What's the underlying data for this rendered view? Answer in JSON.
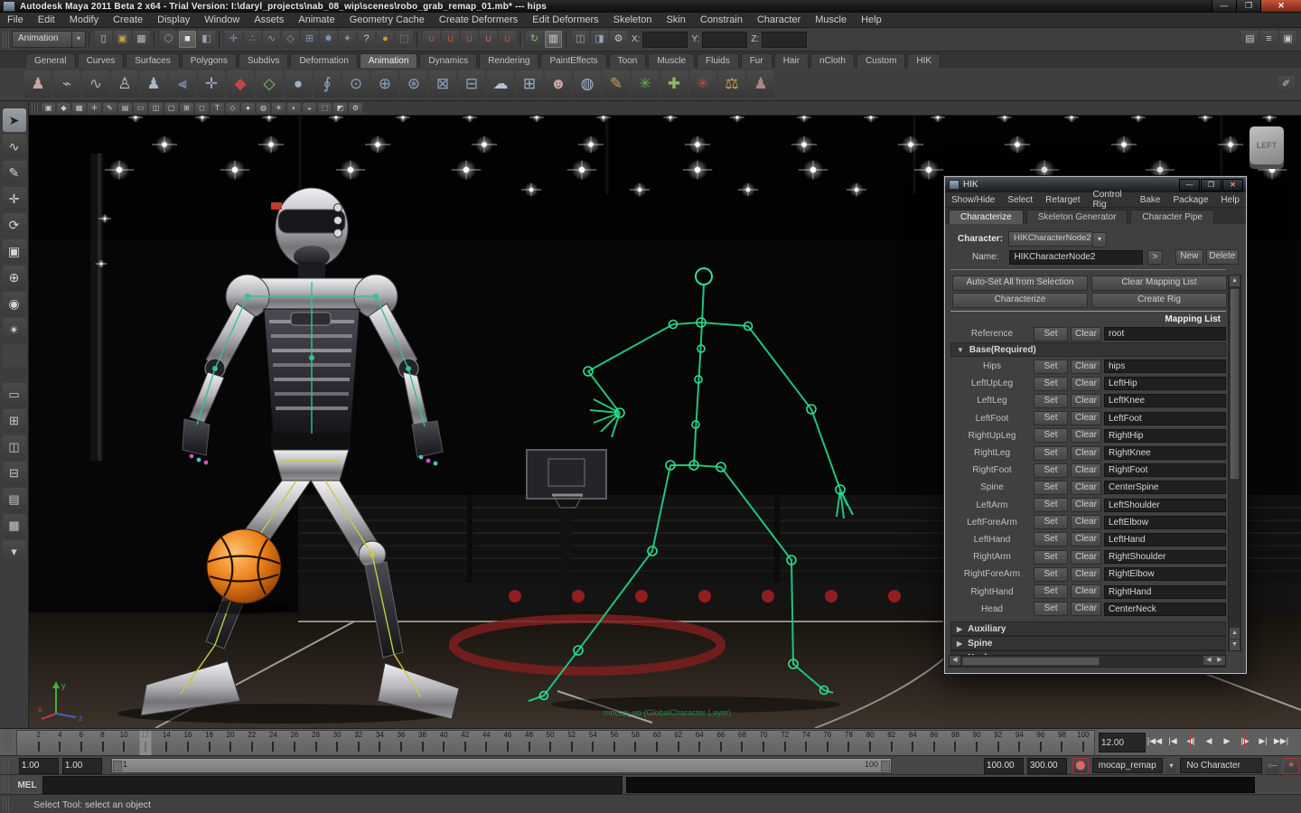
{
  "window": {
    "title": "Autodesk Maya 2011 Beta 2 x64 - Trial Version: I:\\daryl_projects\\nab_08_wip\\scenes\\robo_grab_remap_01.mb*   ---   hips",
    "minimize": "—",
    "maximize": "❐",
    "close": "✕"
  },
  "menu_bar": [
    "File",
    "Edit",
    "Modify",
    "Create",
    "Display",
    "Window",
    "Assets",
    "Animate",
    "Geometry Cache",
    "Create Deformers",
    "Edit Deformers",
    "Skeleton",
    "Skin",
    "Constrain",
    "Character",
    "Muscle",
    "Help"
  ],
  "status_line": {
    "menuset": "Animation",
    "coord_labels": [
      "X:",
      "Y:",
      "Z:"
    ],
    "icons": [
      {
        "n": "new-scene-icon",
        "g": "▯",
        "c": "#c8ced6"
      },
      {
        "n": "open-scene-icon",
        "g": "▣",
        "c": "#c9a24a"
      },
      {
        "n": "save-scene-icon",
        "g": "▦",
        "c": "#b8bec6"
      },
      "|",
      {
        "n": "select-hierarchy-mode-icon",
        "g": "⬡",
        "c": "#9aa4b2"
      },
      {
        "n": "select-object-mode-icon",
        "g": "■",
        "c": "#e0e5ea",
        "active": true
      },
      {
        "n": "select-component-mode-icon",
        "g": "◧",
        "c": "#9aa4b2"
      },
      "|",
      {
        "n": "mask-handles-icon",
        "g": "✛",
        "c": "#7f94b5"
      },
      {
        "n": "mask-joints-icon",
        "g": "∴",
        "c": "#7f94b5"
      },
      {
        "n": "mask-curves-icon",
        "g": "∿",
        "c": "#7f94b5"
      },
      {
        "n": "mask-surfaces-icon",
        "g": "◇",
        "c": "#7f94b5"
      },
      {
        "n": "mask-deformations-icon",
        "g": "⊞",
        "c": "#7f94b5"
      },
      {
        "n": "mask-dynamics-icon",
        "g": "✸",
        "c": "#7f94b5"
      },
      {
        "n": "mask-rendering-icon",
        "g": "✦",
        "c": "#7f94b5"
      },
      {
        "n": "mask-misc-icon",
        "g": "?",
        "c": "#c2c8d0"
      },
      {
        "n": "lock-selection-icon",
        "g": "●",
        "c": "#c9a227"
      },
      {
        "n": "highlight-selection-icon",
        "g": "⬚",
        "c": "#9aa4b2"
      },
      "|",
      {
        "n": "snap-to-grid-icon",
        "g": "∪",
        "c": "#c05040"
      },
      {
        "n": "snap-to-curve-icon",
        "g": "∪",
        "c": "#c05040"
      },
      {
        "n": "snap-to-point-icon",
        "g": "∪",
        "c": "#c05040"
      },
      {
        "n": "snap-to-projected-center-icon",
        "g": "∪",
        "c": "#b07070"
      },
      {
        "n": "snap-to-view-plane-icon",
        "g": "∪",
        "c": "#c05040"
      },
      "|",
      {
        "n": "construction-history-icon",
        "g": "↻",
        "c": "#7fc06a"
      },
      {
        "n": "list-input-operations-icon",
        "g": "▥",
        "c": "#d5dade",
        "active": true
      },
      "|",
      {
        "n": "render-current-frame-icon",
        "g": "◫",
        "c": "#9aa4b2"
      },
      {
        "n": "ipr-render-icon",
        "g": "◨",
        "c": "#9aa4b2"
      },
      {
        "n": "render-settings-icon",
        "g": "⚙",
        "c": "#c2c8d0"
      }
    ],
    "right_icons": [
      {
        "n": "show-channel-box-icon",
        "g": "▤",
        "c": "#c2c8d0"
      },
      {
        "n": "show-layer-editor-icon",
        "g": "≡",
        "c": "#c2c8d0"
      },
      {
        "n": "show-attribute-editor-icon",
        "g": "▣",
        "c": "#c2c8d0"
      }
    ]
  },
  "shelf": {
    "tabs": [
      "General",
      "Curves",
      "Surfaces",
      "Polygons",
      "Subdivs",
      "Deformation",
      "Animation",
      "Dynamics",
      "Rendering",
      "PaintEffects",
      "Toon",
      "Muscle",
      "Fluids",
      "Fur",
      "Hair",
      "nCloth",
      "Custom",
      "HIK"
    ],
    "active_tab": "Animation",
    "icons": [
      {
        "n": "shelf-joint-tool-icon",
        "g": "♟",
        "c": "#c9a8a0"
      },
      {
        "n": "shelf-ik-handle-icon",
        "g": "⌁",
        "c": "#9fb0c8"
      },
      {
        "n": "shelf-ik-spline-icon",
        "g": "∿",
        "c": "#9fb0c8"
      },
      {
        "n": "shelf-character-icon",
        "g": "♙",
        "c": "#b9c2cf"
      },
      {
        "n": "shelf-skeleton-icon",
        "g": "♟",
        "c": "#aab6c6"
      },
      {
        "n": "shelf-mirror-joint-icon",
        "g": "⫷",
        "c": "#93a8c2"
      },
      {
        "n": "shelf-orient-joint-icon",
        "g": "✛",
        "c": "#93a8c2"
      },
      {
        "n": "shelf-set-key-icon",
        "g": "◆",
        "c": "#c04848"
      },
      {
        "n": "shelf-set-breakdown-icon",
        "g": "◇",
        "c": "#88bb66"
      },
      {
        "n": "shelf-hold-key-icon",
        "g": "●",
        "c": "#9db3c9"
      },
      {
        "n": "shelf-motion-path-icon",
        "g": "∮",
        "c": "#90a6c0"
      },
      {
        "n": "shelf-constraint-point-icon",
        "g": "⊙",
        "c": "#8aa0ba"
      },
      {
        "n": "shelf-constraint-aim-icon",
        "g": "⊕",
        "c": "#8aa0ba"
      },
      {
        "n": "shelf-constraint-orient-icon",
        "g": "⊛",
        "c": "#8aa0ba"
      },
      {
        "n": "shelf-constraint-scale-icon",
        "g": "⊠",
        "c": "#8aa0ba"
      },
      {
        "n": "shelf-constraint-parent-icon",
        "g": "⊟",
        "c": "#8aa0ba"
      },
      {
        "n": "shelf-cluster-icon",
        "g": "☁",
        "c": "#b7c2cf"
      },
      {
        "n": "shelf-lattice-icon",
        "g": "⊞",
        "c": "#9db0c6"
      },
      {
        "n": "shelf-blendshape-icon",
        "g": "☻",
        "c": "#c4a5a0"
      },
      {
        "n": "shelf-wrap-icon",
        "g": "◍",
        "c": "#a2b5ca"
      },
      {
        "n": "shelf-paint-weights-icon",
        "g": "✎",
        "c": "#caa24a"
      },
      {
        "n": "shelf-green-star-icon",
        "g": "✳",
        "c": "#5fae4f"
      },
      {
        "n": "shelf-cross-icon",
        "g": "✚",
        "c": "#88bb66"
      },
      {
        "n": "shelf-red-star-icon",
        "g": "✳",
        "c": "#c04848"
      },
      {
        "n": "shelf-ik-fk-blend-icon",
        "g": "⚖",
        "c": "#caa24a"
      },
      {
        "n": "shelf-pose-icon",
        "g": "♟",
        "c": "#b28585"
      }
    ],
    "right_icon": {
      "n": "shelf-editor-icon",
      "g": "✐",
      "c": "#c2c8d0"
    }
  },
  "toolbox": {
    "tools": [
      {
        "n": "select-tool",
        "g": "➤",
        "active": true
      },
      {
        "n": "lasso-select-tool",
        "g": "∿"
      },
      {
        "n": "paint-select-tool",
        "g": "✎"
      },
      {
        "n": "move-tool",
        "g": "✛"
      },
      {
        "n": "rotate-tool",
        "g": "⟳"
      },
      {
        "n": "scale-tool",
        "g": "▣"
      },
      {
        "n": "universal-manipulator-tool",
        "g": "⊕"
      },
      {
        "n": "soft-modification-tool",
        "g": "◉"
      },
      {
        "n": "show-manipulator-tool",
        "g": "✴"
      },
      {
        "n": "last-tool-slot",
        "g": "",
        "blank": true
      }
    ],
    "layouts": [
      {
        "n": "layout-single-pane",
        "g": "▭"
      },
      {
        "n": "layout-four-pane",
        "g": "⊞"
      },
      {
        "n": "layout-two-pane-side",
        "g": "◫"
      },
      {
        "n": "layout-two-pane-stacked",
        "g": "⊟"
      },
      {
        "n": "layout-persp-outliner",
        "g": "▤"
      },
      {
        "n": "layout-hypergraph-persp",
        "g": "▦"
      }
    ],
    "more": {
      "n": "layout-more-dropdown",
      "g": "▾"
    }
  },
  "viewport": {
    "toolbar_icons": [
      {
        "n": "vp-camera-attributes-icon",
        "g": "▣"
      },
      {
        "n": "vp-bookmark-icon",
        "g": "◆"
      },
      {
        "n": "vp-image-plane-icon",
        "g": "▦"
      },
      {
        "n": "vp-2d-pan-zoom-icon",
        "g": "✛"
      },
      {
        "n": "vp-grease-pencil-icon",
        "g": "✎"
      },
      {
        "n": "vp-grid-icon",
        "g": "▤"
      },
      {
        "n": "vp-film-gate-icon",
        "g": "▭"
      },
      {
        "n": "vp-resolution-gate-icon",
        "g": "◫"
      },
      {
        "n": "vp-gate-mask-icon",
        "g": "▢"
      },
      {
        "n": "vp-field-chart-icon",
        "g": "⊞"
      },
      {
        "n": "vp-safe-action-icon",
        "g": "◻"
      },
      {
        "n": "vp-safe-title-icon",
        "g": "T"
      },
      {
        "n": "vp-wireframe-icon",
        "g": "◇"
      },
      {
        "n": "vp-shaded-icon",
        "g": "●"
      },
      {
        "n": "vp-textured-icon",
        "g": "◍"
      },
      {
        "n": "vp-use-all-lights-icon",
        "g": "☀"
      },
      {
        "n": "vp-shadows-icon",
        "g": "◐"
      },
      {
        "n": "vp-default-material-icon",
        "g": "◒"
      },
      {
        "n": "vp-isolate-select-icon",
        "g": "⬚"
      },
      {
        "n": "vp-xray-icon",
        "g": "◩"
      },
      {
        "n": "vp-exposure-icon",
        "g": "⚙"
      }
    ],
    "view_cube_label": "LEFT",
    "hud_text": "mocap_up (GlobalCharacter Layer)",
    "axis": {
      "x": "x",
      "y": "y",
      "z": "z"
    }
  },
  "scene": {
    "lights": [
      [
        150,
        130,
        0.55
      ],
      [
        224,
        130,
        0.55
      ],
      [
        298,
        130,
        0.55
      ],
      [
        372,
        130,
        0.55
      ],
      [
        446,
        130,
        0.55
      ],
      [
        520,
        130,
        0.55
      ],
      [
        594,
        130,
        0.55
      ],
      [
        668,
        130,
        0.55
      ],
      [
        742,
        130,
        0.55
      ],
      [
        816,
        130,
        0.55
      ],
      [
        890,
        130,
        0.55
      ],
      [
        964,
        130,
        0.55
      ],
      [
        1038,
        130,
        0.55
      ],
      [
        1112,
        130,
        0.55
      ],
      [
        1186,
        130,
        0.55
      ],
      [
        1260,
        130,
        0.55
      ],
      [
        1334,
        130,
        0.55
      ],
      [
        1405,
        130,
        0.55
      ],
      [
        182,
        160,
        1
      ],
      [
        300,
        160,
        1
      ],
      [
        418,
        160,
        1
      ],
      [
        536,
        160,
        1
      ],
      [
        654,
        160,
        1
      ],
      [
        772,
        160,
        1
      ],
      [
        890,
        160,
        1
      ],
      [
        1008,
        160,
        1
      ],
      [
        1126,
        160,
        1
      ],
      [
        1244,
        160,
        1
      ],
      [
        1362,
        160,
        1
      ],
      [
        132,
        188,
        1.15
      ],
      [
        260,
        188,
        1.15
      ],
      [
        388,
        188,
        1.15
      ],
      [
        516,
        188,
        1.15
      ],
      [
        644,
        188,
        1.15
      ],
      [
        772,
        188,
        1.15
      ],
      [
        900,
        188,
        1.15
      ],
      [
        1028,
        188,
        1.15
      ],
      [
        1156,
        188,
        1.15
      ],
      [
        1284,
        188,
        1.15
      ],
      [
        1408,
        188,
        1.15
      ],
      [
        588,
        210,
        0.8
      ],
      [
        708,
        210,
        0.8
      ],
      [
        828,
        210,
        0.8
      ],
      [
        948,
        210,
        0.8
      ],
      [
        1062,
        210,
        0.8
      ],
      [
        116,
        242,
        0.5
      ],
      [
        112,
        292,
        0.45
      ]
    ]
  },
  "hik": {
    "title": "HIK",
    "minimize": "—",
    "maximize": "❐",
    "close": "✕",
    "menus": [
      "Show/Hide",
      "Select",
      "Retarget",
      "Control Rig",
      "Bake",
      "Package",
      "Help"
    ],
    "tabs": [
      "Characterize",
      "Skeleton Generator",
      "Character Pipe"
    ],
    "active_tab": "Characterize",
    "character_label": "Character:",
    "character_value": "HIKCharacterNode2",
    "name_label": "Name:",
    "name_value": "HIKCharacterNode2",
    "arrow_button": ">",
    "new_button": "New",
    "delete_button": "Delete",
    "buttons": {
      "autoset": "Auto-Set All from Selection",
      "clear_mapping": "Clear Mapping List",
      "characterize": "Characterize",
      "create_rig": "Create Rig"
    },
    "mapping": {
      "header": "Mapping List",
      "set_label": "Set",
      "clear_label": "Clear",
      "reference": {
        "slot": "Reference",
        "value": "root"
      },
      "base_section": "Base(Required)",
      "rows": [
        {
          "slot": "Hips",
          "value": "hips"
        },
        {
          "slot": "LeftUpLeg",
          "value": "LeftHip"
        },
        {
          "slot": "LeftLeg",
          "value": "LeftKnee"
        },
        {
          "slot": "LeftFoot",
          "value": "LeftFoot"
        },
        {
          "slot": "RightUpLeg",
          "value": "RightHip"
        },
        {
          "slot": "RightLeg",
          "value": "RightKnee"
        },
        {
          "slot": "RightFoot",
          "value": "RightFoot"
        },
        {
          "slot": "Spine",
          "value": "CenterSpine"
        },
        {
          "slot": "LeftArm",
          "value": "LeftShoulder"
        },
        {
          "slot": "LeftForeArm",
          "value": "LeftElbow"
        },
        {
          "slot": "LeftHand",
          "value": "LeftHand"
        },
        {
          "slot": "RightArm",
          "value": "RightShoulder"
        },
        {
          "slot": "RightForeArm",
          "value": "RightElbow"
        },
        {
          "slot": "RightHand",
          "value": "RightHand"
        },
        {
          "slot": "Head",
          "value": "CenterNeck"
        }
      ],
      "collapsed_sections": [
        "Auxiliary",
        "Spine",
        "Neck"
      ]
    }
  },
  "time_slider": {
    "start": 1,
    "end": 100,
    "label_step": 2,
    "current": 12,
    "current_time_value": "12.00",
    "playback": [
      {
        "n": "go-to-start-button",
        "g": "|◀◀"
      },
      {
        "n": "step-back-frame-button",
        "g": "|◀"
      },
      {
        "n": "step-back-key-button",
        "g": "◀|",
        "red": true
      },
      {
        "n": "play-backward-button",
        "g": "◀"
      },
      {
        "n": "play-forward-button",
        "g": "▶"
      },
      {
        "n": "step-forward-key-button",
        "g": "|▶",
        "red": true
      },
      {
        "n": "step-forward-frame-button",
        "g": "▶|"
      },
      {
        "n": "go-to-end-button",
        "g": "▶▶|"
      }
    ]
  },
  "range_slider": {
    "anim_start": "1.00",
    "play_start": "1.00",
    "range_start_label": "1",
    "range_end_label": "100",
    "play_end": "100.00",
    "anim_end": "300.00",
    "character_menu": "mocap_remap",
    "character_set": "No Character Set"
  },
  "command_line": {
    "label": "MEL",
    "input": "",
    "result": ""
  },
  "help_line": "Select Tool: select an object"
}
